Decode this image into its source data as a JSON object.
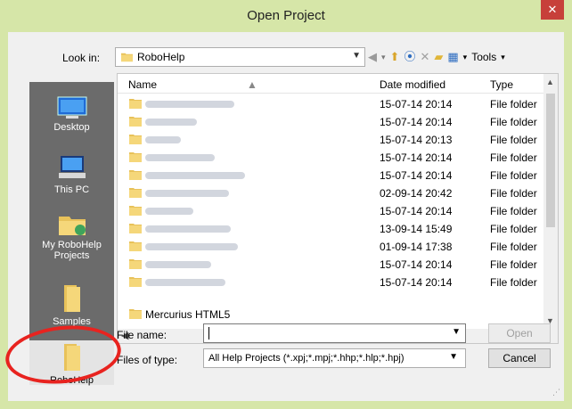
{
  "window": {
    "title": "Open Project",
    "close_symbol": "✕",
    "accent": "#d6e6a8",
    "close_color": "#c7403a"
  },
  "lookin": {
    "label": "Look in:",
    "value": "RoboHelp"
  },
  "toolbar": {
    "tools_label": "Tools"
  },
  "places": [
    {
      "label": "Desktop",
      "icon": "desktop-icon"
    },
    {
      "label": "This PC",
      "icon": "computer-icon"
    },
    {
      "label": "My RoboHelp Projects",
      "icon": "projects-folder-icon"
    },
    {
      "label": "Samples",
      "icon": "folder-icon"
    },
    {
      "label": "RoboHelp",
      "icon": "folder-icon",
      "selected": true
    }
  ],
  "list": {
    "columns": [
      "Name",
      "Date modified",
      "Type"
    ],
    "rows": [
      {
        "date": "15-07-14 20:14",
        "type": "File folder",
        "name_redacted": true
      },
      {
        "date": "15-07-14 20:14",
        "type": "File folder",
        "name_redacted": true
      },
      {
        "date": "15-07-14 20:13",
        "type": "File folder",
        "name_redacted": true
      },
      {
        "date": "15-07-14 20:14",
        "type": "File folder",
        "name_redacted": true
      },
      {
        "date": "15-07-14 20:14",
        "type": "File folder",
        "name_redacted": true
      },
      {
        "date": "02-09-14 20:42",
        "type": "File folder",
        "name_redacted": true
      },
      {
        "date": "15-07-14 20:14",
        "type": "File folder",
        "name_redacted": true
      },
      {
        "date": "13-09-14 15:49",
        "type": "File folder",
        "name_redacted": true
      },
      {
        "date": "01-09-14 17:38",
        "type": "File folder",
        "name_redacted": true
      },
      {
        "date": "15-07-14 20:14",
        "type": "File folder",
        "name_redacted": true
      },
      {
        "date": "15-07-14 20:14",
        "type": "File folder",
        "name_redacted": true
      }
    ],
    "partial_row_name": "Mercurius HTML5"
  },
  "filename": {
    "label": "File name:",
    "value": ""
  },
  "filetype": {
    "label": "Files of type:",
    "value": "All Help Projects (*.xpj;*.mpj;*.hhp;*.hlp;*.hpj)"
  },
  "buttons": {
    "open": "Open",
    "cancel": "Cancel"
  },
  "annotation": {
    "color": "#e8231f"
  }
}
